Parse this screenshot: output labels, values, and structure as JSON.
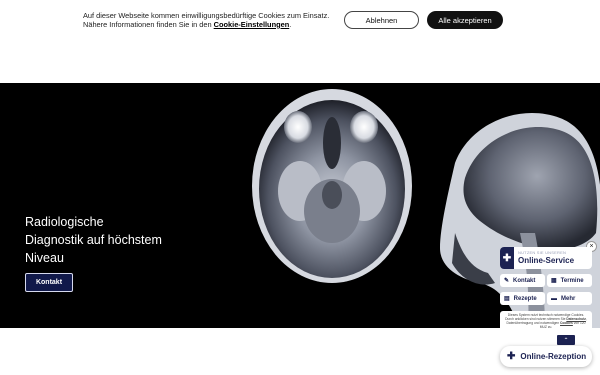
{
  "cookie": {
    "text_line": "Auf dieser Webseite kommen einwilligungsbedürftige Cookies zum Einsatz.",
    "text_more": "Nähere Informationen finden Sie in den",
    "link": "Cookie-Einstellungen",
    "period": ".",
    "decline_label": "Ablehnen",
    "accept_label": "Alle akzeptieren"
  },
  "hero": {
    "title": "Radiologische Diagnostik auf höchstem Niveau",
    "button_label": "Kontakt"
  },
  "service": {
    "close_icon": "×",
    "subtitle": "NUTZEN SIE UNSEREN",
    "title": "Online-Service",
    "buttons": [
      {
        "icon": "✎",
        "label": "Kontakt"
      },
      {
        "icon": "▦",
        "label": "Termine"
      },
      {
        "icon": "▤",
        "label": "Rezepte"
      },
      {
        "icon": "▬",
        "label": "Mehr"
      }
    ],
    "note_start": "Dieses System nutzt technisch notwendige Cookies. Durch anklicken sind nutzen stimmen Sie",
    "note_link1": "Datenschutz",
    "note_mid": ", Datenübertragung und notwendigen",
    "note_link2": "Cookies",
    "note_end": "von 120 MUZ zu.",
    "up_icon": "⌃",
    "rezeption_label": "Online-Rezeption"
  },
  "colors": {
    "navy": "#1c2252",
    "hero_button_bg": "#11194a",
    "hero_bg": "#000000"
  }
}
